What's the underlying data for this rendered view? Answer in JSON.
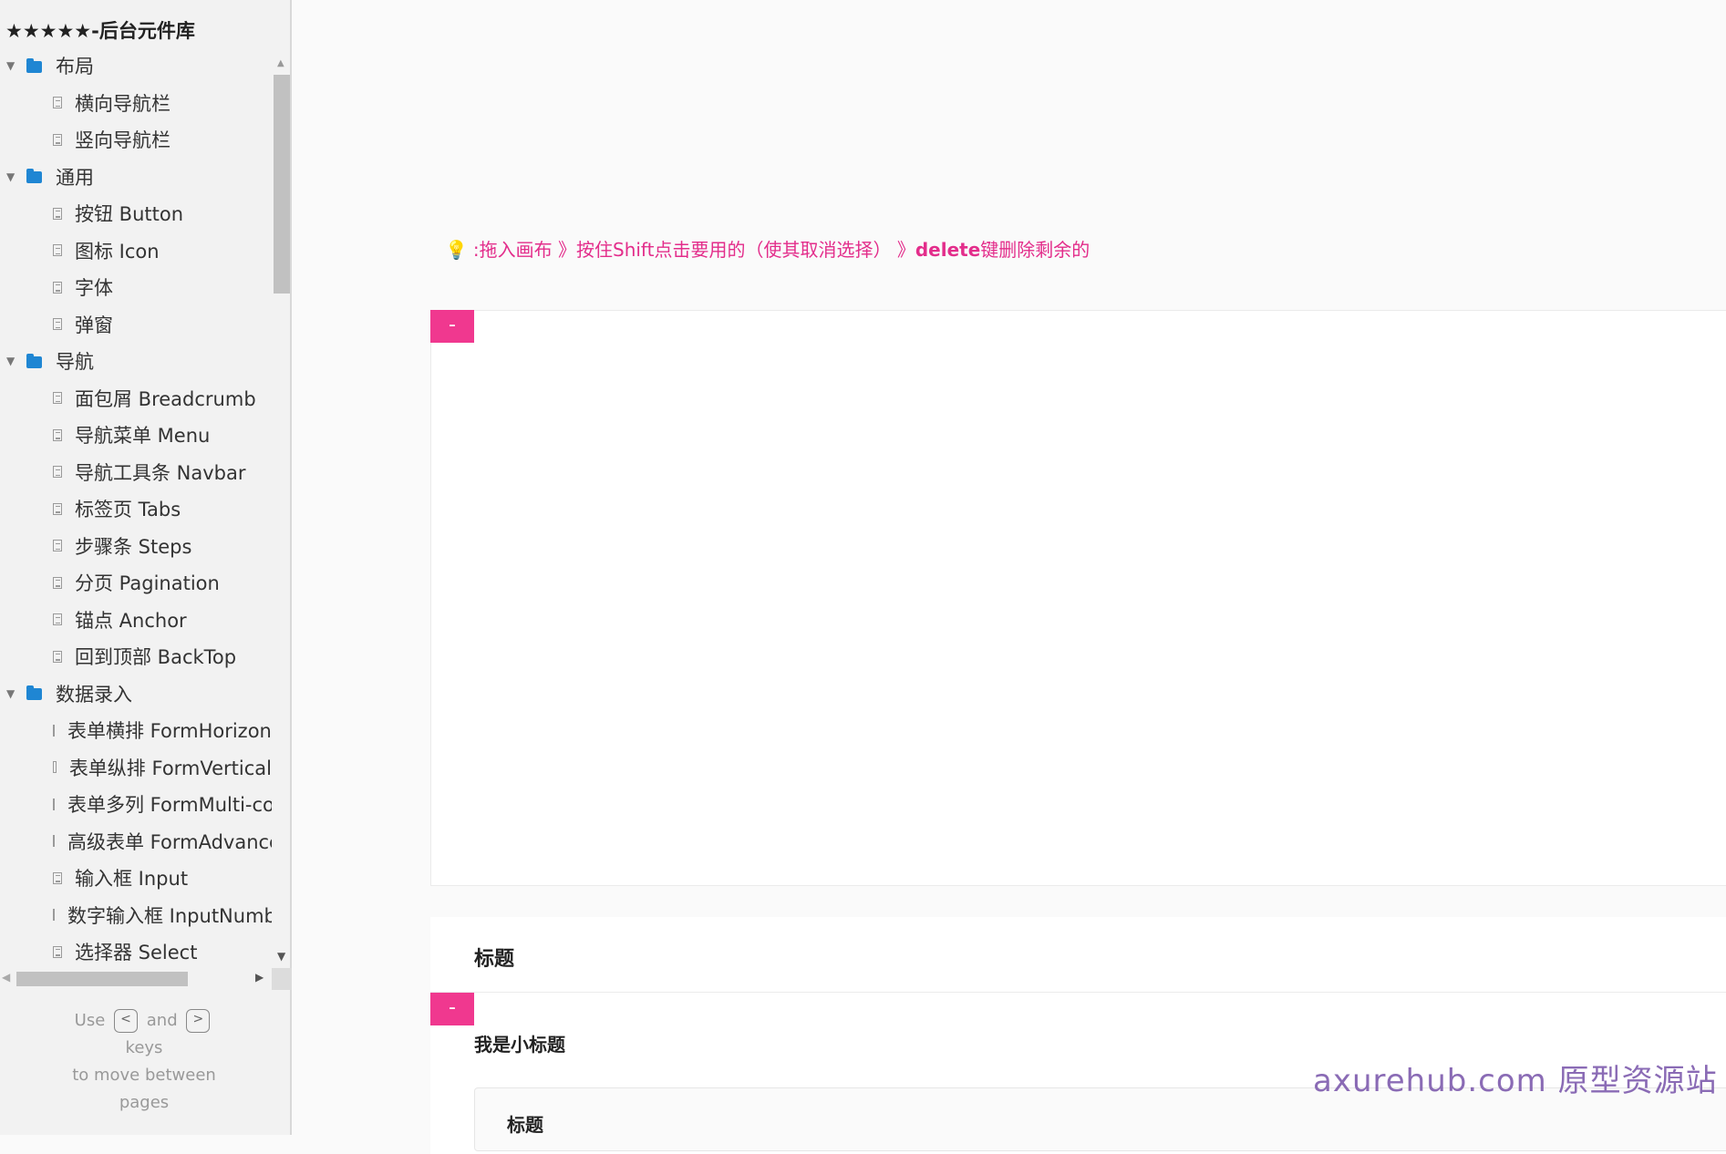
{
  "sidebar": {
    "title": "★★★★★-后台元件库",
    "tree": [
      {
        "type": "folder",
        "label": "布局"
      },
      {
        "type": "page",
        "label": "横向导航栏"
      },
      {
        "type": "page",
        "label": "竖向导航栏"
      },
      {
        "type": "folder",
        "label": "通用"
      },
      {
        "type": "page",
        "label": "按钮 Button"
      },
      {
        "type": "page",
        "label": "图标 Icon"
      },
      {
        "type": "page",
        "label": "字体"
      },
      {
        "type": "page",
        "label": "弹窗"
      },
      {
        "type": "folder",
        "label": "导航"
      },
      {
        "type": "page",
        "label": "面包屑 Breadcrumb"
      },
      {
        "type": "page",
        "label": "导航菜单 Menu"
      },
      {
        "type": "page",
        "label": "导航工具条 Navbar"
      },
      {
        "type": "page",
        "label": "标签页 Tabs"
      },
      {
        "type": "page",
        "label": "步骤条 Steps"
      },
      {
        "type": "page",
        "label": "分页 Pagination"
      },
      {
        "type": "page",
        "label": "锚点 Anchor"
      },
      {
        "type": "page",
        "label": "回到顶部 BackTop"
      },
      {
        "type": "folder",
        "label": "数据录入"
      },
      {
        "type": "page",
        "label": "表单横排 FormHorizontal"
      },
      {
        "type": "page",
        "label": "表单纵排 FormVertical"
      },
      {
        "type": "page",
        "label": "表单多列 FormMulti-column"
      },
      {
        "type": "page",
        "label": "高级表单 FormAdvanced"
      },
      {
        "type": "page",
        "label": "输入框 Input"
      },
      {
        "type": "page",
        "label": "数字输入框 InputNumber"
      },
      {
        "type": "page",
        "label": "选择器 Select"
      }
    ],
    "hint": {
      "use": "Use",
      "prev_key": "<",
      "and": "and",
      "next_key": ">",
      "keys": "keys",
      "to_move": "to move between",
      "pages": "pages"
    }
  },
  "main": {
    "instruction": {
      "part1": ":拖入画布 》按住Shift点击要用的（使其取消选择） 》",
      "part2": "delete",
      "part3": "键删除剩余的"
    },
    "collapse_label": "-",
    "panel2": {
      "title": "标题",
      "subtitle": "我是小标题",
      "card_title": "标题"
    },
    "watermark": "axurehub.com 原型资源站"
  },
  "colors": {
    "accent": "#f0388f",
    "instruction_text": "#e32d8b",
    "folder_icon": "#1f86d3",
    "watermark": "#8a6bb5"
  }
}
